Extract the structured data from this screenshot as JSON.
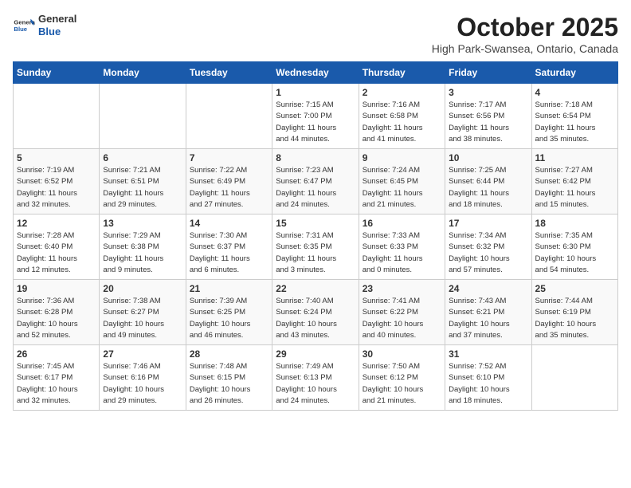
{
  "header": {
    "logo": {
      "general": "General",
      "blue": "Blue"
    },
    "title": "October 2025",
    "location": "High Park-Swansea, Ontario, Canada"
  },
  "weekdays": [
    "Sunday",
    "Monday",
    "Tuesday",
    "Wednesday",
    "Thursday",
    "Friday",
    "Saturday"
  ],
  "weeks": [
    [
      {
        "day": "",
        "info": ""
      },
      {
        "day": "",
        "info": ""
      },
      {
        "day": "",
        "info": ""
      },
      {
        "day": "1",
        "info": "Sunrise: 7:15 AM\nSunset: 7:00 PM\nDaylight: 11 hours\nand 44 minutes."
      },
      {
        "day": "2",
        "info": "Sunrise: 7:16 AM\nSunset: 6:58 PM\nDaylight: 11 hours\nand 41 minutes."
      },
      {
        "day": "3",
        "info": "Sunrise: 7:17 AM\nSunset: 6:56 PM\nDaylight: 11 hours\nand 38 minutes."
      },
      {
        "day": "4",
        "info": "Sunrise: 7:18 AM\nSunset: 6:54 PM\nDaylight: 11 hours\nand 35 minutes."
      }
    ],
    [
      {
        "day": "5",
        "info": "Sunrise: 7:19 AM\nSunset: 6:52 PM\nDaylight: 11 hours\nand 32 minutes."
      },
      {
        "day": "6",
        "info": "Sunrise: 7:21 AM\nSunset: 6:51 PM\nDaylight: 11 hours\nand 29 minutes."
      },
      {
        "day": "7",
        "info": "Sunrise: 7:22 AM\nSunset: 6:49 PM\nDaylight: 11 hours\nand 27 minutes."
      },
      {
        "day": "8",
        "info": "Sunrise: 7:23 AM\nSunset: 6:47 PM\nDaylight: 11 hours\nand 24 minutes."
      },
      {
        "day": "9",
        "info": "Sunrise: 7:24 AM\nSunset: 6:45 PM\nDaylight: 11 hours\nand 21 minutes."
      },
      {
        "day": "10",
        "info": "Sunrise: 7:25 AM\nSunset: 6:44 PM\nDaylight: 11 hours\nand 18 minutes."
      },
      {
        "day": "11",
        "info": "Sunrise: 7:27 AM\nSunset: 6:42 PM\nDaylight: 11 hours\nand 15 minutes."
      }
    ],
    [
      {
        "day": "12",
        "info": "Sunrise: 7:28 AM\nSunset: 6:40 PM\nDaylight: 11 hours\nand 12 minutes."
      },
      {
        "day": "13",
        "info": "Sunrise: 7:29 AM\nSunset: 6:38 PM\nDaylight: 11 hours\nand 9 minutes."
      },
      {
        "day": "14",
        "info": "Sunrise: 7:30 AM\nSunset: 6:37 PM\nDaylight: 11 hours\nand 6 minutes."
      },
      {
        "day": "15",
        "info": "Sunrise: 7:31 AM\nSunset: 6:35 PM\nDaylight: 11 hours\nand 3 minutes."
      },
      {
        "day": "16",
        "info": "Sunrise: 7:33 AM\nSunset: 6:33 PM\nDaylight: 11 hours\nand 0 minutes."
      },
      {
        "day": "17",
        "info": "Sunrise: 7:34 AM\nSunset: 6:32 PM\nDaylight: 10 hours\nand 57 minutes."
      },
      {
        "day": "18",
        "info": "Sunrise: 7:35 AM\nSunset: 6:30 PM\nDaylight: 10 hours\nand 54 minutes."
      }
    ],
    [
      {
        "day": "19",
        "info": "Sunrise: 7:36 AM\nSunset: 6:28 PM\nDaylight: 10 hours\nand 52 minutes."
      },
      {
        "day": "20",
        "info": "Sunrise: 7:38 AM\nSunset: 6:27 PM\nDaylight: 10 hours\nand 49 minutes."
      },
      {
        "day": "21",
        "info": "Sunrise: 7:39 AM\nSunset: 6:25 PM\nDaylight: 10 hours\nand 46 minutes."
      },
      {
        "day": "22",
        "info": "Sunrise: 7:40 AM\nSunset: 6:24 PM\nDaylight: 10 hours\nand 43 minutes."
      },
      {
        "day": "23",
        "info": "Sunrise: 7:41 AM\nSunset: 6:22 PM\nDaylight: 10 hours\nand 40 minutes."
      },
      {
        "day": "24",
        "info": "Sunrise: 7:43 AM\nSunset: 6:21 PM\nDaylight: 10 hours\nand 37 minutes."
      },
      {
        "day": "25",
        "info": "Sunrise: 7:44 AM\nSunset: 6:19 PM\nDaylight: 10 hours\nand 35 minutes."
      }
    ],
    [
      {
        "day": "26",
        "info": "Sunrise: 7:45 AM\nSunset: 6:17 PM\nDaylight: 10 hours\nand 32 minutes."
      },
      {
        "day": "27",
        "info": "Sunrise: 7:46 AM\nSunset: 6:16 PM\nDaylight: 10 hours\nand 29 minutes."
      },
      {
        "day": "28",
        "info": "Sunrise: 7:48 AM\nSunset: 6:15 PM\nDaylight: 10 hours\nand 26 minutes."
      },
      {
        "day": "29",
        "info": "Sunrise: 7:49 AM\nSunset: 6:13 PM\nDaylight: 10 hours\nand 24 minutes."
      },
      {
        "day": "30",
        "info": "Sunrise: 7:50 AM\nSunset: 6:12 PM\nDaylight: 10 hours\nand 21 minutes."
      },
      {
        "day": "31",
        "info": "Sunrise: 7:52 AM\nSunset: 6:10 PM\nDaylight: 10 hours\nand 18 minutes."
      },
      {
        "day": "",
        "info": ""
      }
    ]
  ]
}
